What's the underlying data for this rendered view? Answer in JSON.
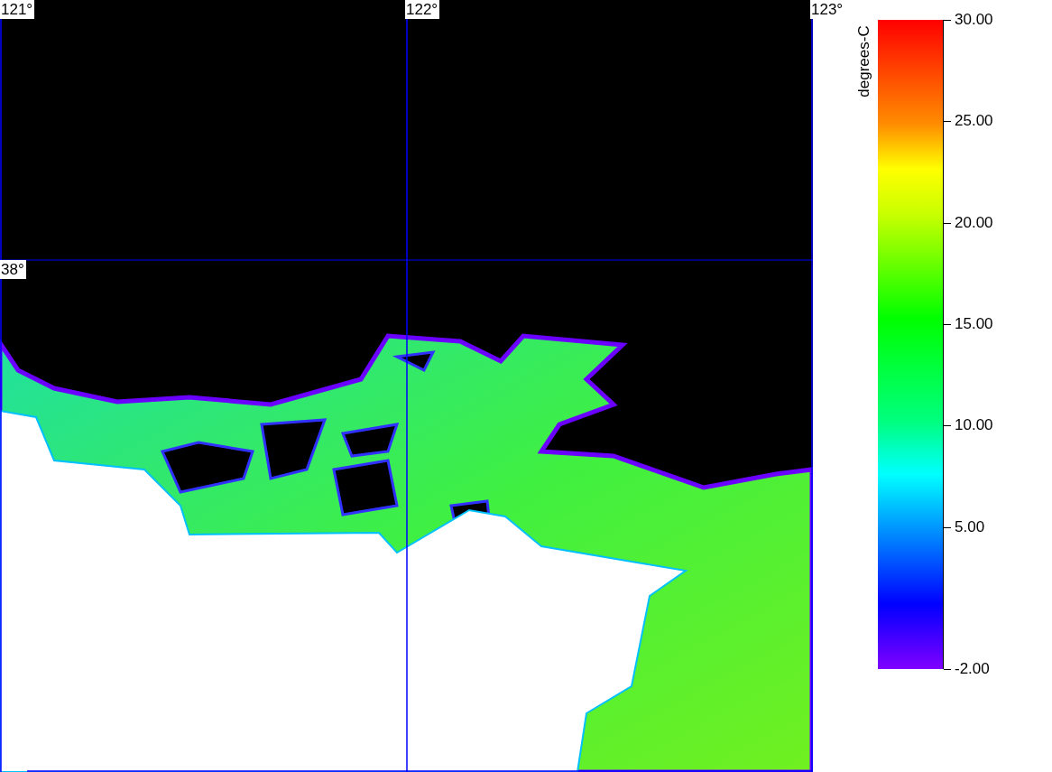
{
  "map": {
    "longitude_labels": [
      "121°",
      "122°",
      "123°"
    ],
    "latitude_labels": [
      "38°"
    ]
  },
  "color_scale": {
    "title": "degrees-C",
    "ticks": [
      "30.00",
      "25.00",
      "20.00",
      "15.00",
      "10.00",
      "5.00",
      "-2.00"
    ]
  }
}
